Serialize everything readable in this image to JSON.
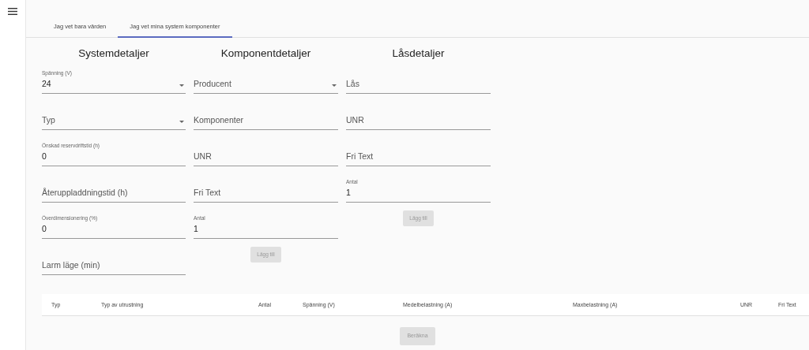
{
  "tabs": [
    {
      "label": "Jag vet bara värden",
      "selected": false
    },
    {
      "label": "Jag vet mina system komponenter",
      "selected": true
    }
  ],
  "columns": [
    {
      "heading": "Systemdetaljer",
      "fields": [
        {
          "kind": "select",
          "label": "Spänning (V)",
          "value": "24"
        },
        {
          "kind": "select",
          "placeholder": "Typ"
        },
        {
          "kind": "text",
          "label": "Önskad reservdriftstid (h)",
          "value": "0"
        },
        {
          "kind": "text",
          "placeholder": "Återuppladdningstid (h)"
        },
        {
          "kind": "text",
          "label": "Överdimensionering (%)",
          "value": "0"
        },
        {
          "kind": "text",
          "placeholder": "Larm läge (min)"
        }
      ]
    },
    {
      "heading": "Komponentdetaljer",
      "fields": [
        {
          "kind": "select",
          "placeholder": "Producent"
        },
        {
          "kind": "text",
          "placeholder": "Komponenter"
        },
        {
          "kind": "text",
          "placeholder": "UNR"
        },
        {
          "kind": "text",
          "placeholder": "Fri Text"
        },
        {
          "kind": "text",
          "label": "Antal",
          "value": "1"
        }
      ],
      "button": {
        "label": "Lägg till",
        "disabled": true
      }
    },
    {
      "heading": "Låsdetaljer",
      "fields": [
        {
          "kind": "text",
          "placeholder": "Lås"
        },
        {
          "kind": "text",
          "placeholder": "UNR"
        },
        {
          "kind": "text",
          "placeholder": "Fri Text"
        },
        {
          "kind": "text",
          "label": "Antal",
          "value": "1"
        }
      ],
      "button": {
        "label": "Lägg till",
        "disabled": true
      }
    }
  ],
  "table": {
    "columns": [
      "Typ",
      "Typ av utrustning",
      "Antal",
      "Spänning (V)",
      "Medelbelastning (A)",
      "Maxbelastning (A)",
      "UNR",
      "Fri Text"
    ]
  },
  "calculate_button": {
    "label": "Beräkna",
    "disabled": true
  }
}
